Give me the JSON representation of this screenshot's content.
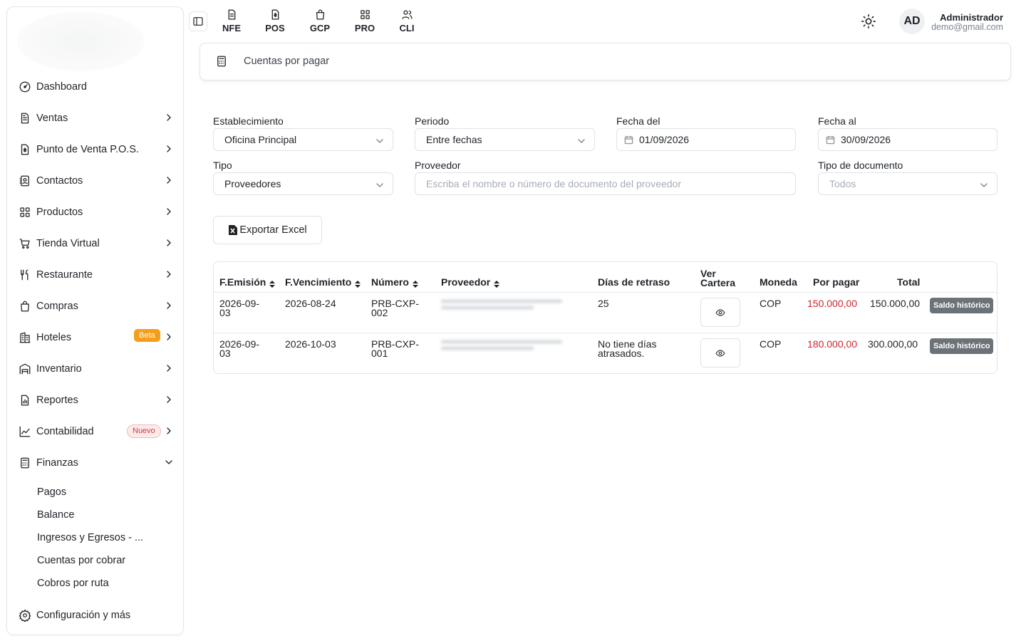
{
  "sidebar": {
    "items": [
      {
        "label": "Dashboard"
      },
      {
        "label": "Ventas"
      },
      {
        "label": "Punto de Venta P.O.S."
      },
      {
        "label": "Contactos"
      },
      {
        "label": "Productos"
      },
      {
        "label": "Tienda Virtual"
      },
      {
        "label": "Restaurante"
      },
      {
        "label": "Compras"
      },
      {
        "label": "Hoteles",
        "badge": "Beta"
      },
      {
        "label": "Inventario"
      },
      {
        "label": "Reportes"
      },
      {
        "label": "Contabilidad",
        "badge": "Nuevo"
      },
      {
        "label": "Finanzas"
      }
    ],
    "sub_items": [
      "Pagos",
      "Balance",
      "Ingresos y Egresos - ...",
      "Cuentas por cobrar",
      "Cobros por ruta"
    ],
    "footer": "Configuración y más"
  },
  "topbar": {
    "quick_links": [
      "NFE",
      "POS",
      "GCP",
      "PRO",
      "CLI"
    ],
    "avatar": "AD",
    "user_name": "Administrador",
    "user_email": "demo@gmail.com"
  },
  "page": {
    "title": "Cuentas por pagar"
  },
  "filters": {
    "establecimiento": {
      "label": "Establecimiento",
      "value": "Oficina Principal"
    },
    "periodo": {
      "label": "Periodo",
      "value": "Entre fechas"
    },
    "fecha_del": {
      "label": "Fecha del",
      "value": "01/09/2026"
    },
    "fecha_al": {
      "label": "Fecha al",
      "value": "30/09/2026"
    },
    "tipo": {
      "label": "Tipo",
      "value": "Proveedores"
    },
    "proveedor": {
      "label": "Proveedor",
      "placeholder": "Escriba el nombre o número de documento del proveedor"
    },
    "tipo_documento": {
      "label": "Tipo de documento",
      "placeholder": "Todos"
    }
  },
  "export_label": "Exportar Excel",
  "table": {
    "headers": {
      "emision": "F.Emisión",
      "vencimiento": "F.Vencimiento",
      "numero": "Número",
      "proveedor": "Proveedor",
      "dias": "Días de retraso",
      "cartera_1": "Ver",
      "cartera_2": "Cartera",
      "moneda": "Moneda",
      "por_pagar": "Por pagar",
      "total": "Total"
    },
    "rows": [
      {
        "emision_1": "2026-09-",
        "emision_2": "03",
        "vencimiento": "2026-08-24",
        "numero_1": "PRB-CXP-",
        "numero_2": "002",
        "dias_1": "25",
        "dias_2": "",
        "moneda": "COP",
        "por_pagar": "150.000,00",
        "total": "150.000,00",
        "badge": "Saldo histórico"
      },
      {
        "emision_1": "2026-09-",
        "emision_2": "03",
        "vencimiento": "2026-10-03",
        "numero_1": "PRB-CXP-",
        "numero_2": "001",
        "dias_1": "No tiene días",
        "dias_2": "atrasados.",
        "moneda": "COP",
        "por_pagar": "180.000,00",
        "total": "300.000,00",
        "badge": "Saldo histórico"
      }
    ]
  },
  "colors": {
    "accent_red": "#d0262f",
    "beta_badge": "#f59e1b",
    "saldo_badge": "#6c7378"
  }
}
